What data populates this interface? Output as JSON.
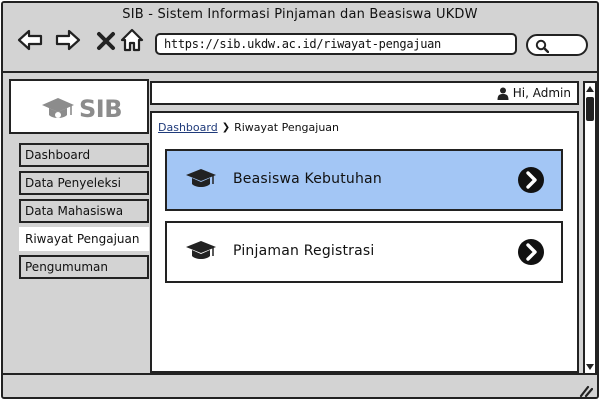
{
  "window": {
    "title": "SIB - Sistem Informasi Pinjaman dan Beasiswa UKDW"
  },
  "browser": {
    "url": "https://sib.ukdw.ac.id/riwayat-pengajuan",
    "icons": [
      "back-arrow-icon",
      "forward-arrow-icon",
      "close-icon",
      "home-icon",
      "search-icon"
    ]
  },
  "sidebar": {
    "logo_text": "SIB",
    "items": [
      {
        "label": "Dashboard"
      },
      {
        "label": "Data Penyeleksi"
      },
      {
        "label": "Data Mahasiswa"
      },
      {
        "label": "Riwayat Pengajuan"
      },
      {
        "label": "Pengumuman"
      }
    ],
    "active_item": "Riwayat Pengajuan"
  },
  "header": {
    "greeting": "Hi, Admin",
    "icon": "user-icon"
  },
  "breadcrumb": {
    "root": "Dashboard",
    "current": "Riwayat Pengajuan"
  },
  "cards": [
    {
      "label": "Beasiswa Kebutuhan",
      "icon": "graduation-cap-icon",
      "highlighted": true
    },
    {
      "label": "Pinjaman Registrasi",
      "icon": "graduation-cap-icon",
      "highlighted": false
    }
  ],
  "colors": {
    "highlight": "#a3c6f5",
    "chrome": "#d3d3d3",
    "link": "#1f3a7a"
  }
}
